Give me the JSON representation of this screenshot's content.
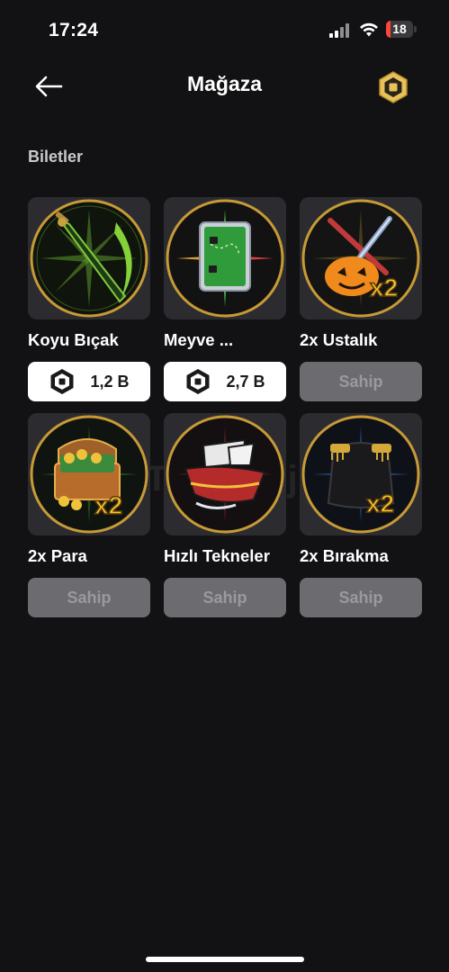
{
  "status": {
    "time": "17:24",
    "battery": "18",
    "battery_level": 0.18
  },
  "header": {
    "title": "Mağaza",
    "back_icon": "arrow-left-icon",
    "currency_icon": "robux-icon"
  },
  "section": {
    "title": "Biletler"
  },
  "colors": {
    "background": "#121214",
    "card": "#2c2c30",
    "owned_button": "#6b6b70",
    "buy_button": "#ffffff",
    "gold": "#d4a93a"
  },
  "items": [
    {
      "name": "Koyu Bıçak",
      "art": "dark-blade-icon",
      "button": {
        "type": "buy",
        "price": "1,2 B"
      }
    },
    {
      "name": "Meyve ...",
      "art": "fruit-map-icon",
      "button": {
        "type": "buy",
        "price": "2,7 B"
      }
    },
    {
      "name": "2x Ustalık",
      "art": "mastery-x2-icon",
      "button": {
        "type": "owned",
        "label": "Sahip"
      }
    },
    {
      "name": "2x Para",
      "art": "money-chest-x2-icon",
      "button": {
        "type": "owned",
        "label": "Sahip"
      }
    },
    {
      "name": "Hızlı Tekneler",
      "art": "fast-boat-icon",
      "button": {
        "type": "owned",
        "label": "Sahip"
      }
    },
    {
      "name": "2x Bırakma",
      "art": "drop-coat-x2-icon",
      "button": {
        "type": "owned",
        "label": "Sahip"
      }
    }
  ]
}
